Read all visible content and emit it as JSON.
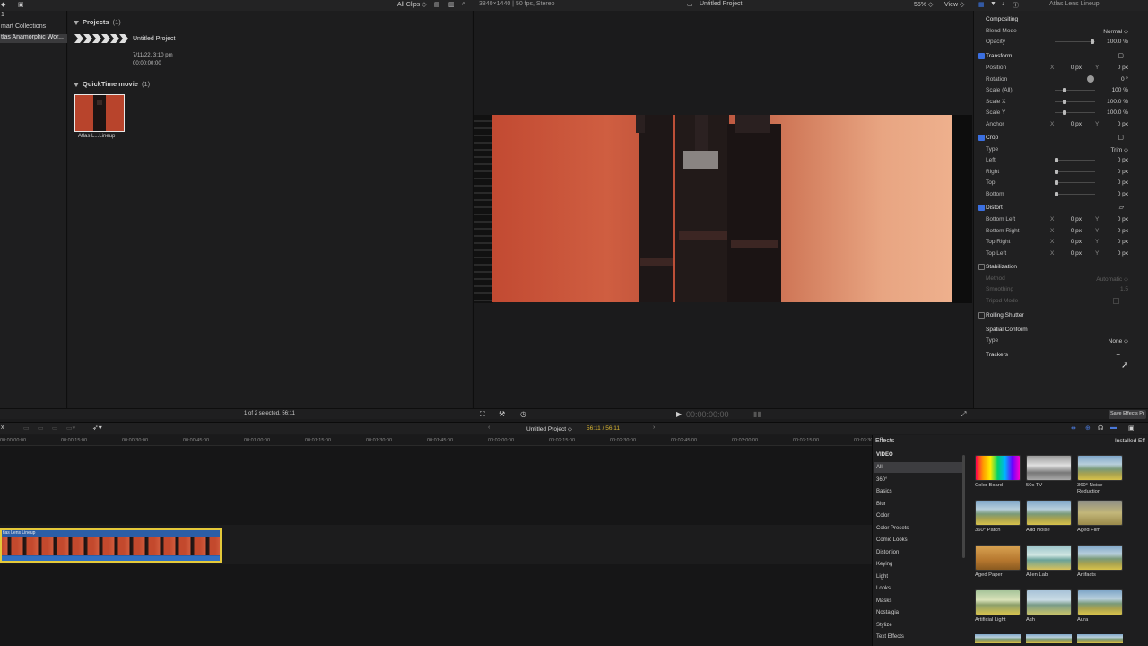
{
  "topbar": {
    "clips_filter": "All Clips ◇",
    "format": "3840×1440 | 50 fps, Stereo",
    "project_title": "Untitled Project",
    "zoom": "55% ◇",
    "view_menu": "View ◇",
    "inspector_title": "Atlas Lens Lineup"
  },
  "library": {
    "items": [
      "1",
      "mart Collections",
      "tlas Anamorphic Wor..."
    ]
  },
  "browser": {
    "projects_header": "Projects",
    "projects_count": "(1)",
    "project_name": "Untitled Project",
    "project_date": "7/11/22, 3:10 pm",
    "project_duration": "00:00:00:00",
    "qt_header": "QuickTime movie",
    "qt_count": "(1)",
    "clip_name": "Atlas L...Lineup",
    "status": "1 of 2 selected, 56:11"
  },
  "viewer": {
    "timecode": "00:00:00:00"
  },
  "inspector": {
    "compositing": "Compositing",
    "blend_mode_label": "Blend Mode",
    "blend_mode_value": "Normal ◇",
    "opacity_label": "Opacity",
    "opacity_value": "100.0 %",
    "transform": "Transform",
    "position_label": "Position",
    "position_x": "0 px",
    "position_y": "0 px",
    "rotation_label": "Rotation",
    "rotation_value": "0 °",
    "scale_all_label": "Scale (All)",
    "scale_all_value": "100 %",
    "scale_x_label": "Scale X",
    "scale_x_value": "100.0 %",
    "scale_y_label": "Scale Y",
    "scale_y_value": "100.0 %",
    "anchor_label": "Anchor",
    "anchor_x": "0 px",
    "anchor_y": "0 px",
    "crop": "Crop",
    "crop_type_label": "Type",
    "crop_type_value": "Trim ◇",
    "crop_left_label": "Left",
    "crop_left_value": "0 px",
    "crop_right_label": "Right",
    "crop_right_value": "0 px",
    "crop_top_label": "Top",
    "crop_top_value": "0 px",
    "crop_bottom_label": "Bottom",
    "crop_bottom_value": "0 px",
    "distort": "Distort",
    "bottom_left_label": "Bottom Left",
    "bottom_right_label": "Bottom Right",
    "top_right_label": "Top Right",
    "top_left_label": "Top Left",
    "zero_px": "0 px",
    "stabilization": "Stabilization",
    "method_label": "Method",
    "method_value": "Automatic ◇",
    "smoothing_label": "Smoothing",
    "smoothing_value": "1.5",
    "tripod_label": "Tripod Mode",
    "rolling_shutter": "Rolling Shutter",
    "spatial_conform": "Spatial Conform",
    "spatial_type_label": "Type",
    "spatial_type_value": "None ◇",
    "trackers": "Trackers",
    "save_effects": "Save Effects Pr",
    "axis_x": "X",
    "axis_y": "Y"
  },
  "timeline": {
    "index_label": "x",
    "project_name": "Untitled Project ◇",
    "duration": "56:11 / 56:11",
    "clip_name": "tlas Lens Lineup",
    "ruler": [
      "00:00:00:00",
      "00:00:15:00",
      "00:00:30:00",
      "00:00:45:00",
      "00:01:00:00",
      "00:01:15:00",
      "00:01:30:00",
      "00:01:45:00",
      "00:02:00:00",
      "00:02:15:00",
      "00:02:30:00",
      "00:02:45:00",
      "00:03:00:00",
      "00:03:15:00",
      "00:03:30:00"
    ]
  },
  "effects": {
    "header": "Effects",
    "installed": "Installed Eff",
    "video_label": "VIDEO",
    "categories": [
      "All",
      "360°",
      "Basics",
      "Blur",
      "Color",
      "Color Presets",
      "Comic Looks",
      "Distortion",
      "Keying",
      "Light",
      "Looks",
      "Masks",
      "Nostalgia",
      "Stylize",
      "Text Effects"
    ],
    "items": [
      "Color Board",
      "50s TV",
      "360° Noise Reduction",
      "360° Patch",
      "Add Noise",
      "Aged Film",
      "Aged Paper",
      "Alien Lab",
      "Artifacts",
      "Artificial Light",
      "Ash",
      "Aura"
    ]
  }
}
